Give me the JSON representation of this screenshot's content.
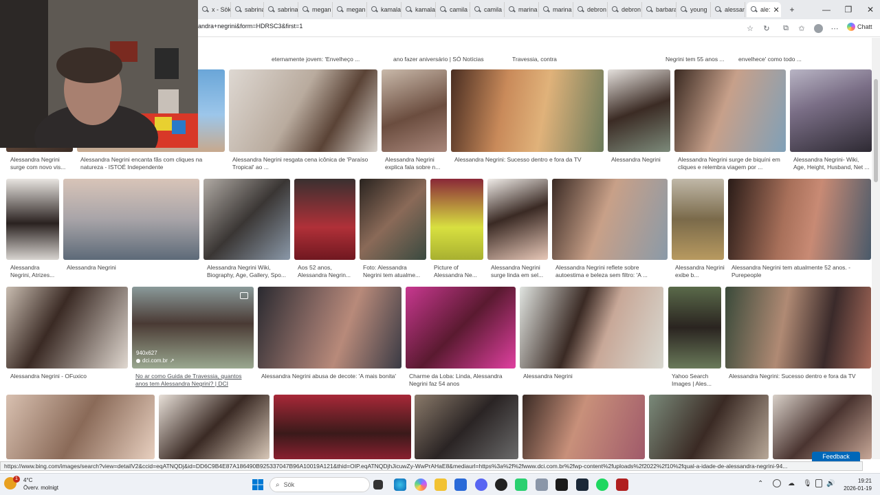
{
  "tabs": [
    {
      "label": "x - Sök"
    },
    {
      "label": "sabrina"
    },
    {
      "label": "sabrina"
    },
    {
      "label": "megan"
    },
    {
      "label": "megan"
    },
    {
      "label": "kamala"
    },
    {
      "label": "kamala"
    },
    {
      "label": "camila c"
    },
    {
      "label": "camila c"
    },
    {
      "label": "marina"
    },
    {
      "label": "marina"
    },
    {
      "label": "debron"
    },
    {
      "label": "debron"
    },
    {
      "label": "barbara"
    },
    {
      "label": "young"
    },
    {
      "label": "alessan"
    },
    {
      "label": "ale:"
    }
  ],
  "address_bar": {
    "url": "andra+negrini&form=HDRSC3&first=1",
    "copilot_label": "Chatt"
  },
  "top_row_captions": [
    "eternamente jovem: 'Envelheço ...",
    "ano fazer aniversário | SÓ Notícias",
    "Travessia, contra",
    "Negrini tem 55 anos ...",
    "envelhece' como todo ..."
  ],
  "row1": [
    {
      "caption": "Alessandra Negrini surge com novo vis..."
    },
    {
      "caption": "Alessandra Negrini encanta fãs com cliques na natureza - ISTOÉ Independente"
    },
    {
      "caption": "Alessandra Negrini resgata cena icônica de 'Paraíso Tropical' ao ..."
    },
    {
      "caption": "Alessandra Negrini explica fala sobre n..."
    },
    {
      "caption": "Alessandra Negrini: Sucesso dentro e fora da TV"
    },
    {
      "caption": "Alessandra Negrini"
    },
    {
      "caption": "Alessandra Negrini surge de biquíni em cliques e relembra viagem por ..."
    },
    {
      "caption": "Alessandra Negrini- Wiki, Age, Height, Husband, Net ..."
    }
  ],
  "row2": [
    {
      "caption": "Alessandra Negrini, Atrizes..."
    },
    {
      "caption": "Alessandra Negrini"
    },
    {
      "caption": "Alessandra Negrini Wiki, Biography, Age, Gallery, Spo..."
    },
    {
      "caption": "Aos 52 anos, Alessandra Negrin..."
    },
    {
      "caption": "Foto: Alessandra Negrini tem atualme..."
    },
    {
      "caption": "Picture of Alessandra Ne..."
    },
    {
      "caption": "Alessandra Negrini surge linda em sel..."
    },
    {
      "caption": "Alessandra Negrini reflete sobre autoestima e beleza sem filtro: 'A ..."
    },
    {
      "caption": "Alessandra Negrini exibe b..."
    },
    {
      "caption": "Alessandra Negrini tem atualmente 52 anos. - Purepeople"
    }
  ],
  "row3": [
    {
      "caption": "Alessandra Negrini - OFuxico"
    },
    {
      "caption": "No ar como Guida de Travessia, quantos anos tem Alessandra Negrini? | DCI",
      "size": "940x627",
      "source": "dci.com.br"
    },
    {
      "caption": "Alessandra Negrini abusa de decote: 'A mais bonita'"
    },
    {
      "caption": "Charme da Loba: Linda, Alessandra Negrini faz 54 anos"
    },
    {
      "caption": "Alessandra Negrini"
    },
    {
      "caption": "Yahoo Search Images | Ales..."
    },
    {
      "caption": "Alessandra Negrini: Sucesso dentro e fora da TV"
    }
  ],
  "status_url": "https://www.bing.com/images/search?view=detailV2&ccid=eqATNQDj&id=DD6C9B4E87A186490B925337047B96A10019A121&thid=OIP.eqATNQDjhJicuwZy-WwPrAHaE8&mediaurl=https%3a%2f%2fwww.dci.com.br%2fwp-content%2fuploads%2f2022%2f10%2fqual-a-idade-de-alessandra-negrini-94...",
  "feedback_label": "Feedback",
  "taskbar": {
    "weather_temp": "4°C",
    "weather_desc": "Överv. molnigt",
    "notification_count": "1",
    "search_placeholder": "Sök",
    "time": "19:21",
    "date": "2026-01-19"
  }
}
